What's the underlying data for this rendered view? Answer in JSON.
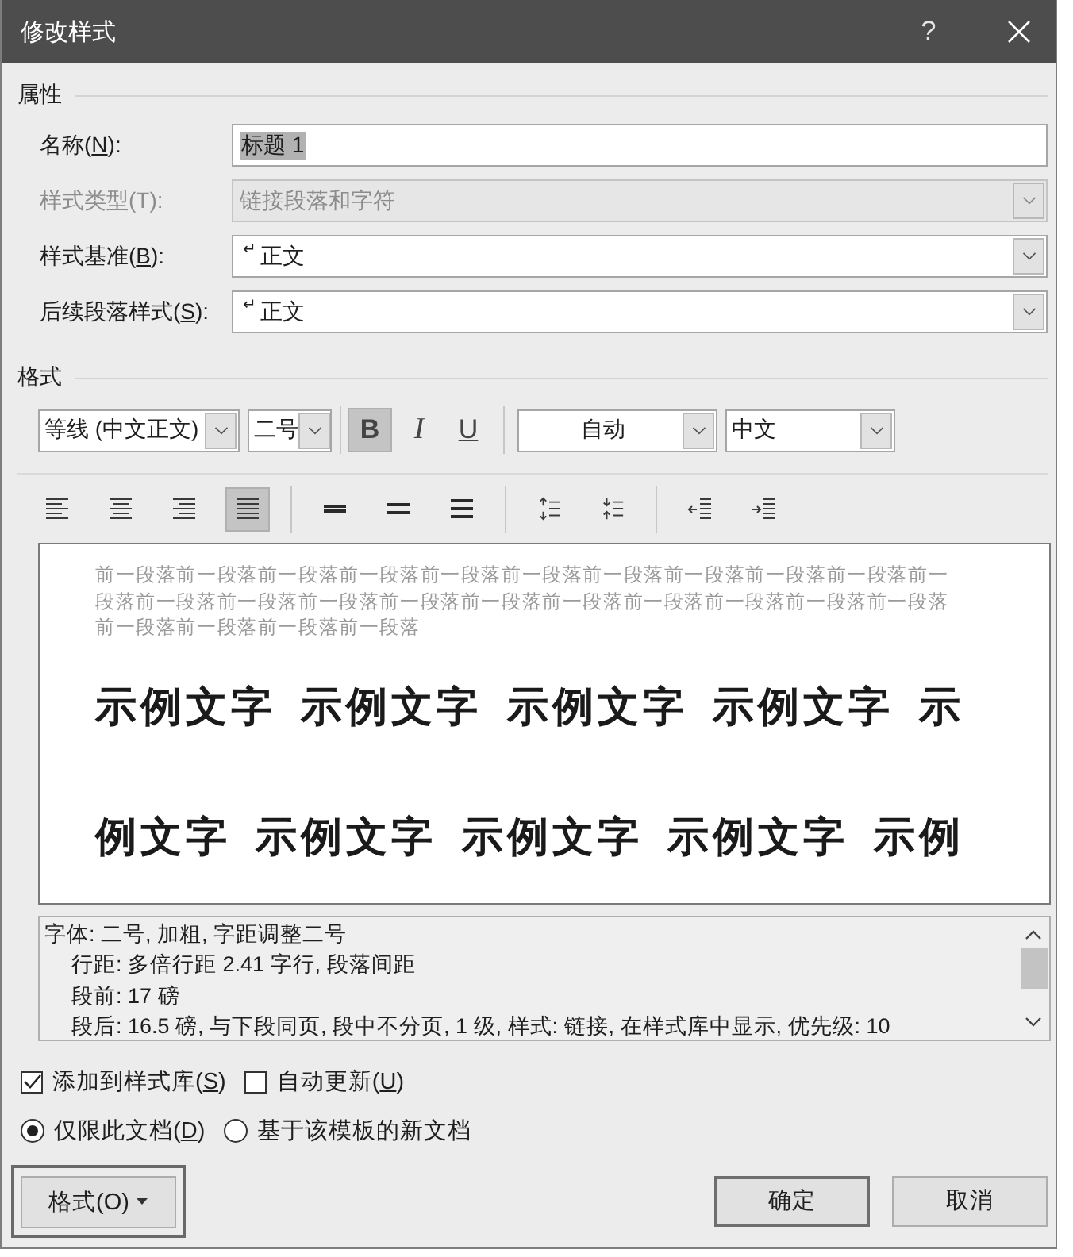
{
  "window": {
    "title": "修改样式",
    "help": "?"
  },
  "properties": {
    "heading": "属性",
    "fields": [
      {
        "kind": "text",
        "label": "名称(",
        "access_key": "N",
        "label_end": "):",
        "value": "标题 1",
        "value_selected": true,
        "disabled": false
      },
      {
        "kind": "dropdown",
        "label": "样式类型(T):",
        "value": "链接段落和字符",
        "disabled": true
      },
      {
        "kind": "dropdown",
        "label": "样式基准(",
        "access_key": "B",
        "label_end": "):",
        "symbol": "↵",
        "value": "正文",
        "disabled": false
      },
      {
        "kind": "dropdown",
        "label": "后续段落样式(",
        "access_key": "S",
        "label_end": "):",
        "symbol": "↵",
        "value": "正文",
        "disabled": false
      }
    ]
  },
  "format": {
    "heading": "格式",
    "font": "等线 (中文正文)",
    "size": "二号",
    "styles": [
      {
        "kind": "bold",
        "glyph": "B",
        "selected": true
      },
      {
        "kind": "italic",
        "glyph": "I",
        "selected": false
      },
      {
        "kind": "underline",
        "glyph": "U",
        "selected": false
      }
    ],
    "font_color_setting": "自动",
    "script": "中文",
    "alignment": [
      {
        "kind": "left",
        "selected": false
      },
      {
        "kind": "center",
        "selected": false
      },
      {
        "kind": "right",
        "selected": false
      },
      {
        "kind": "justify",
        "selected": true
      }
    ],
    "line_spacing": [
      {
        "kind": "single",
        "selected": false
      },
      {
        "kind": "one_half",
        "selected": false
      },
      {
        "kind": "double",
        "selected": false
      }
    ],
    "paragraph_spacing": [
      {
        "kind": "increase"
      },
      {
        "kind": "decrease"
      }
    ],
    "indent": [
      {
        "kind": "decrease"
      },
      {
        "kind": "increase"
      }
    ]
  },
  "preview": {
    "previous_paragraph": "前一段落前一段落前一段落前一段落前一段落前一段落前一段落前一段落前一段落前一段落前一段落前一段落前一段落前一段落前一段落前一段落前一段落前一段落前一段落前一段落前一段落前一段落前一段落前一段落前一段落",
    "sample": "示例文字 示例文字 示例文字 示例文字 示例文字 示例文字 示例文字 示例文字 示例"
  },
  "description": {
    "heading": "字体: 二号, 加粗, 字距调整二号",
    "details": [
      "行距: 多倍行距 2.41 字行, 段落间距",
      "段前: 17 磅",
      "段后: 16.5 磅, 与下段同页, 段中不分页, 1 级, 样式: 链接, 在样式库中显示, 优先级: 10"
    ]
  },
  "options": [
    {
      "label": "添加到样式库(",
      "access_key": "S",
      "label_end": ")",
      "checked": true
    },
    {
      "label": "自动更新(",
      "access_key": "U",
      "label_end": ")",
      "checked": false
    }
  ],
  "scope": [
    {
      "label": "仅限此文档(",
      "access_key": "D",
      "label_end": ")",
      "selected": true
    },
    {
      "label": "基于该模板的新文档",
      "selected": false
    }
  ],
  "buttons": [
    {
      "kind": "menu",
      "label": "格式(O)",
      "focused": true
    },
    {
      "kind": "default",
      "label": "确定",
      "focused": false
    },
    {
      "kind": "normal",
      "label": "取消",
      "focused": false
    }
  ]
}
